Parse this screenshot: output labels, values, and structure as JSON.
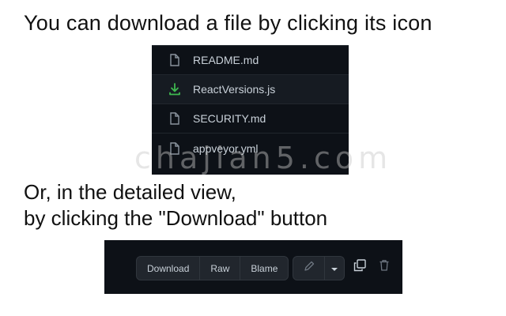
{
  "heading": "You can download a file by clicking its icon",
  "files": [
    {
      "name": "README.md",
      "icon": "file-icon"
    },
    {
      "name": "ReactVersions.js",
      "icon": "download-icon"
    },
    {
      "name": "SECURITY.md",
      "icon": "file-icon"
    },
    {
      "name": "appveyor.yml",
      "icon": "file-icon"
    }
  ],
  "caption": {
    "line1": "Or, in the detailed view,",
    "line2": "by clicking the \"Download\" button"
  },
  "toolbar": {
    "download_label": "Download",
    "raw_label": "Raw",
    "blame_label": "Blame",
    "edit_icon": "pencil-icon",
    "dropdown_icon": "triangle-down-icon",
    "copy_icon": "copy-icon",
    "delete_icon": "trash-icon"
  },
  "watermark": "chajian5.com",
  "colors": {
    "panel_bg": "#0d1117",
    "text": "#c9d1d9",
    "icon_gray": "#8b949e",
    "download_green": "#3fb950"
  }
}
